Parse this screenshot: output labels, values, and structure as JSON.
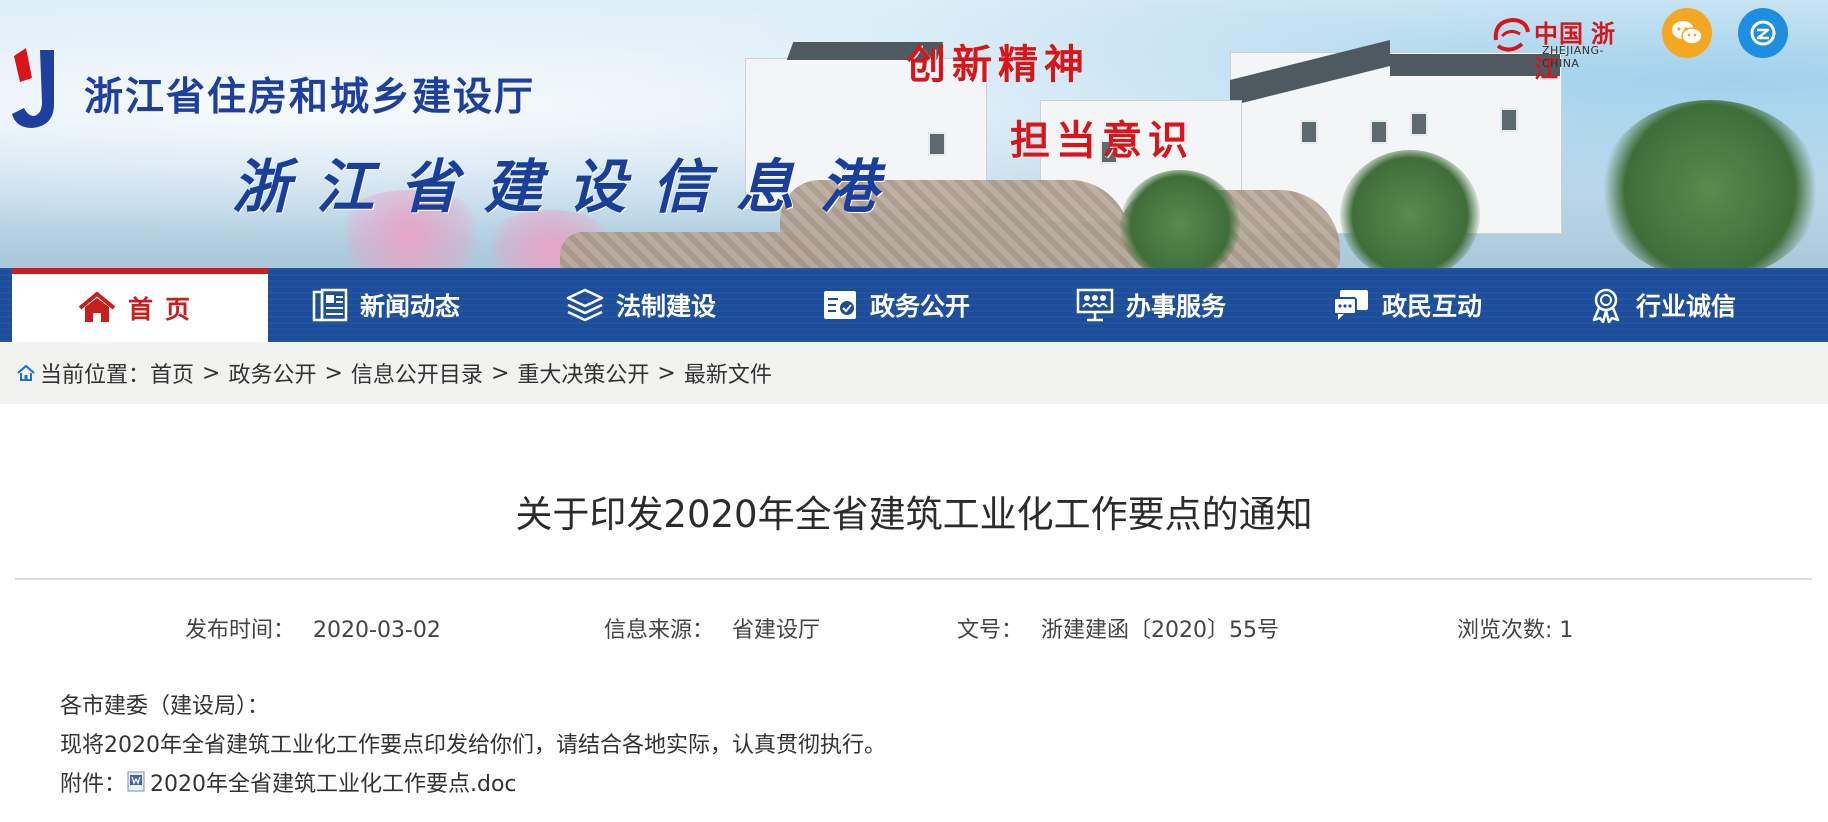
{
  "header": {
    "org_name": "浙江省住房和城乡建设厅",
    "site_name": "浙江省建设信息港",
    "slogan_1": "创新精神",
    "slogan_2": "担当意识",
    "zj_logo_cn": "中国 浙江",
    "zj_logo_en": "ZHEJIANG-CHINA",
    "social_icons": [
      "wechat-icon",
      "weibo-icon"
    ]
  },
  "nav": {
    "items": [
      {
        "label": "首页",
        "icon": "home-icon",
        "active": true
      },
      {
        "label": "新闻动态",
        "icon": "news-icon"
      },
      {
        "label": "法制建设",
        "icon": "layers-icon"
      },
      {
        "label": "政务公开",
        "icon": "check-doc-icon"
      },
      {
        "label": "办事服务",
        "icon": "people-screen-icon"
      },
      {
        "label": "政民互动",
        "icon": "chat-icon"
      },
      {
        "label": "行业诚信",
        "icon": "badge-icon"
      }
    ]
  },
  "breadcrumb": {
    "prefix": "当前位置：",
    "items": [
      "首页",
      "政务公开",
      "信息公开目录",
      "重大决策公开",
      "最新文件"
    ],
    "separator": ">"
  },
  "article": {
    "title": "关于印发2020年全省建筑工业化工作要点的通知",
    "meta": {
      "date_label": "发布时间：",
      "date": "2020-03-02",
      "source_label": "信息来源：",
      "source": "省建设厅",
      "docno_label": "文号：",
      "docno": "浙建建函〔2020〕55号",
      "views_label": "浏览次数:",
      "views": "1"
    },
    "greeting": "各市建委（建设局）：",
    "paragraph": "现将2020年全省建筑工业化工作要点印发给你们，请结合各地实际，认真贯彻执行。",
    "attachment_label": "附件：",
    "attachment_name": "2020年全省建筑工业化工作要点.doc"
  },
  "colors": {
    "nav_bg": "#1d4e9c",
    "active_red": "#c81e1e",
    "slogan_red": "#d7151a",
    "title_blue": "#1a3f9b"
  }
}
